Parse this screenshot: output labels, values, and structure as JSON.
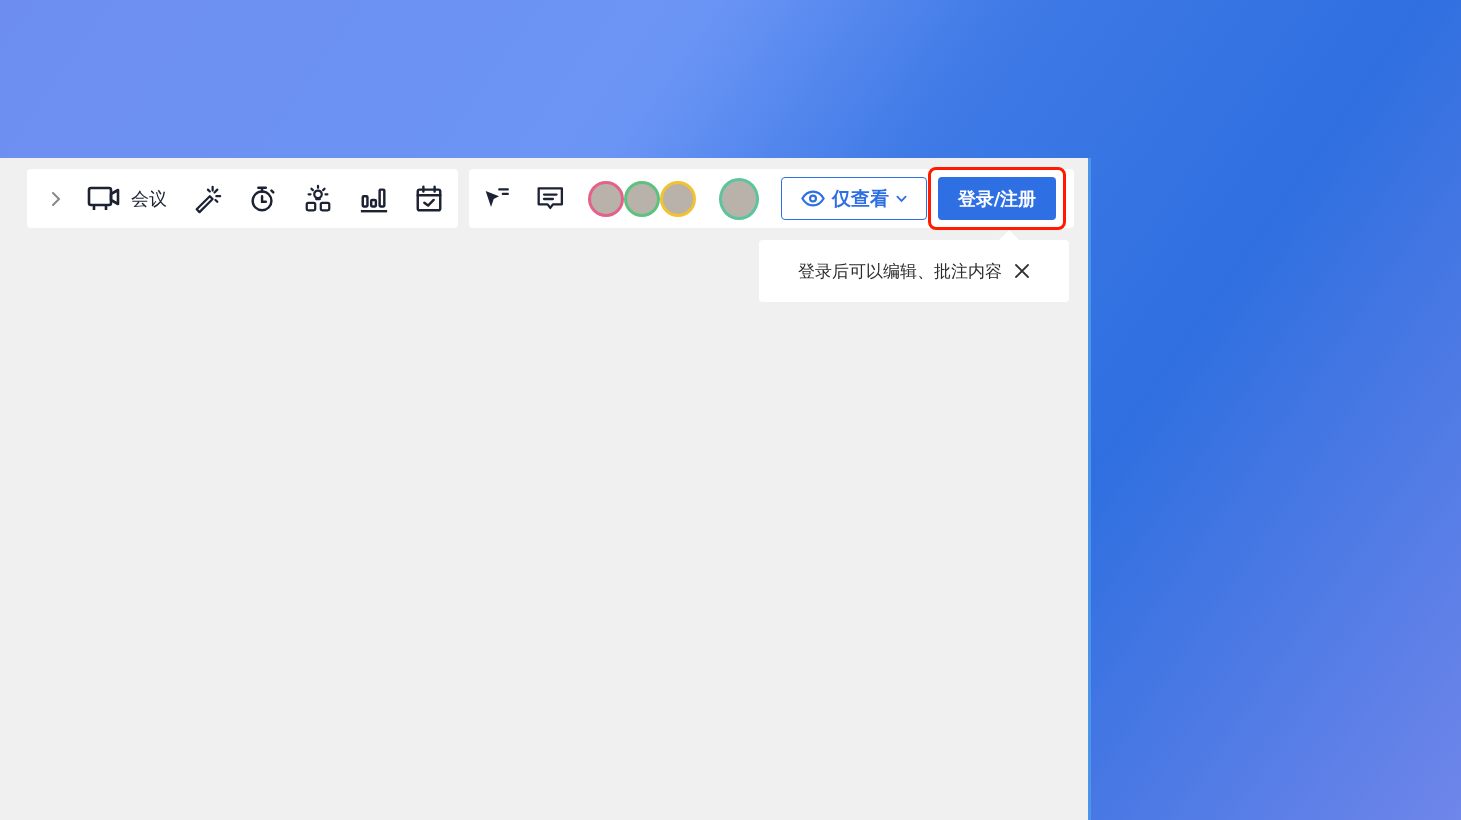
{
  "toolbar": {
    "meeting_label": "会议"
  },
  "participants": [
    {
      "color": "#e2628a"
    },
    {
      "color": "#5cc27e"
    },
    {
      "color": "#f2c230"
    }
  ],
  "other_participant": {
    "color": "#5cc49a"
  },
  "view_mode": {
    "label": "仅查看"
  },
  "login_button": {
    "label": "登录/注册",
    "highlighted": true
  },
  "tooltip": {
    "text": "登录后可以编辑、批注内容"
  }
}
